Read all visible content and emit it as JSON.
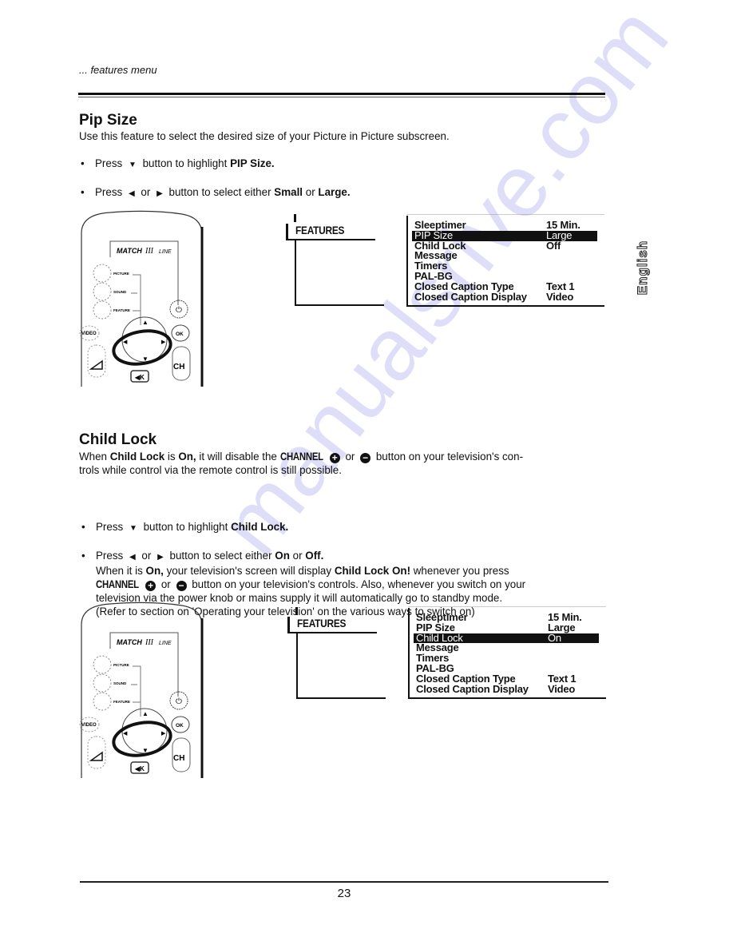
{
  "header": {
    "section_label": "... features menu"
  },
  "pip_size": {
    "title": "Pip Size",
    "intro": "Use this feature to select the desired size of your Picture in Picture subscreen.",
    "bullets": [
      {
        "press": "Press",
        "icon": "down-triangle-icon",
        "text_before": "button to highlight",
        "bold": "PIP Size."
      },
      {
        "press": "Press",
        "icon_left": "left-triangle-icon",
        "or": "or",
        "icon_right": "right-triangle-icon",
        "text_before": "button to select either",
        "bold1": "Small",
        "or2": "or",
        "bold2": "Large."
      }
    ],
    "features_tab_title": "FEATURES",
    "menu": [
      {
        "label": "Sleeptimer",
        "value": "15 Min.",
        "selected": false
      },
      {
        "label": "PIP Size",
        "value": "Large",
        "selected": true
      },
      {
        "label": "Child Lock",
        "value": "Off",
        "selected": false
      },
      {
        "label": "Message",
        "value": "",
        "selected": false
      },
      {
        "label": "Timers",
        "value": "",
        "selected": false
      },
      {
        "label": "PAL-BG",
        "value": "",
        "selected": false
      },
      {
        "label": "Closed Caption Type",
        "value": "Text 1",
        "selected": false
      },
      {
        "label": "Closed Caption Display",
        "value": "Video",
        "selected": false
      }
    ]
  },
  "child_lock": {
    "title": "Child Lock",
    "intro": {
      "w1": "When",
      "b1": "Child Lock",
      "w2": "is",
      "b2": "On,",
      "w3": "it will disable the",
      "channel": "CHANNEL",
      "or": "or",
      "w4": "button on your television's con-",
      "line2": "trols while control via the remote control is still possible."
    },
    "bullets": [
      {
        "press": "Press",
        "text_before": "button to highlight",
        "bold": "Child Lock."
      },
      {
        "press": "Press",
        "or": "or",
        "text_before": "button to select either",
        "bold1": "On",
        "or2": "or",
        "bold2": "Off."
      }
    ],
    "detail": {
      "w1": "When it is",
      "b1": "On,",
      "w2": "your television's screen will display",
      "b2": "Child Lock On!",
      "w3": "whenever you press",
      "channel": "CHANNEL",
      "or": "or",
      "w4": "button on your television's controls. Also, whenever you switch on your",
      "line3": "television via the power knob or mains supply it will automatically go to standby mode.",
      "line4": "(Refer to section on 'Operating your television' on the various ways to switch on)"
    },
    "features_tab_title": "FEATURES",
    "menu": [
      {
        "label": "Sleeptimer",
        "value": "15 Min.",
        "selected": false
      },
      {
        "label": "PIP Size",
        "value": "Large",
        "selected": false
      },
      {
        "label": "Child Lock",
        "value": "On",
        "selected": true
      },
      {
        "label": "Message",
        "value": "",
        "selected": false
      },
      {
        "label": "Timers",
        "value": "",
        "selected": false
      },
      {
        "label": "PAL-BG",
        "value": "",
        "selected": false
      },
      {
        "label": "Closed Caption Type",
        "value": "Text 1",
        "selected": false
      },
      {
        "label": "Closed Caption Display",
        "value": "Video",
        "selected": false
      }
    ]
  },
  "remote": {
    "brand": "MATCH",
    "brand_suffix": "LINE",
    "buttons": {
      "picture": "PICTURE",
      "sound": "SOUND",
      "feature": "FEATURE",
      "video": "VIDEO",
      "ok": "OK",
      "ch": "CH"
    }
  },
  "side_tab": {
    "language": "English"
  },
  "footer": {
    "page_number": "23"
  },
  "watermark": {
    "text": "manualsrive.com"
  }
}
